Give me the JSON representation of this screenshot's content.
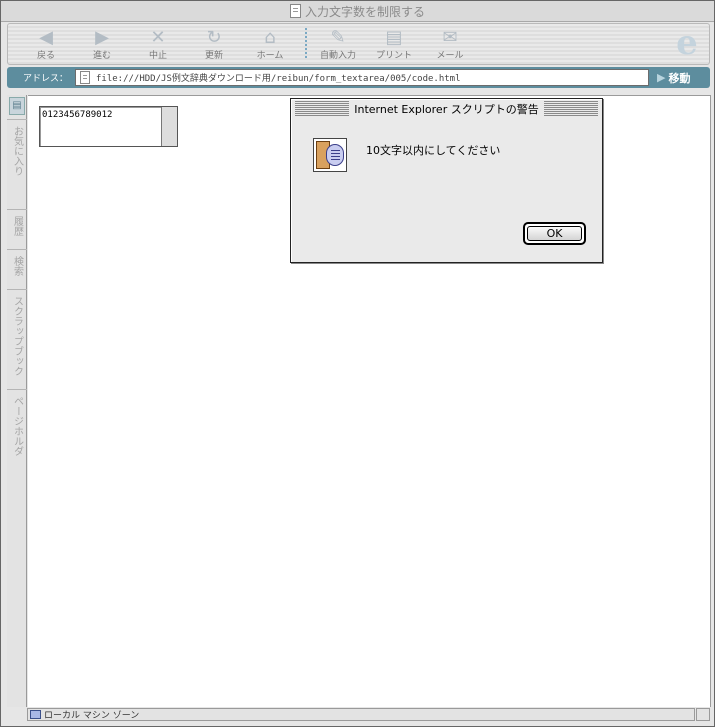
{
  "window": {
    "title": "入力文字数を制限する"
  },
  "toolbar": {
    "buttons": [
      {
        "label": "戻る",
        "icon": "back-arrow-icon"
      },
      {
        "label": "進む",
        "icon": "forward-arrow-icon"
      },
      {
        "label": "中止",
        "icon": "stop-icon"
      },
      {
        "label": "更新",
        "icon": "refresh-icon"
      },
      {
        "label": "ホーム",
        "icon": "home-icon"
      },
      {
        "label": "自動入力",
        "icon": "autofill-icon"
      },
      {
        "label": "プリント",
        "icon": "print-icon"
      },
      {
        "label": "メール",
        "icon": "mail-icon"
      }
    ]
  },
  "address": {
    "label": "アドレス：",
    "url": "file:///HDD/JS例文辞典ダウンロード用/reibun/form_textarea/005/code.html",
    "go_label": "移動"
  },
  "sidebar": {
    "tabs": [
      "お気に入り",
      "履歴",
      "検索",
      "スクラップブック",
      "ページホルダ"
    ]
  },
  "page": {
    "textarea_value": "0123456789012"
  },
  "dialog": {
    "title": "Internet Explorer スクリプトの警告",
    "message": "10文字以内にしてください",
    "ok_label": "OK"
  },
  "status": {
    "zone": "ローカル マシン ゾーン"
  }
}
